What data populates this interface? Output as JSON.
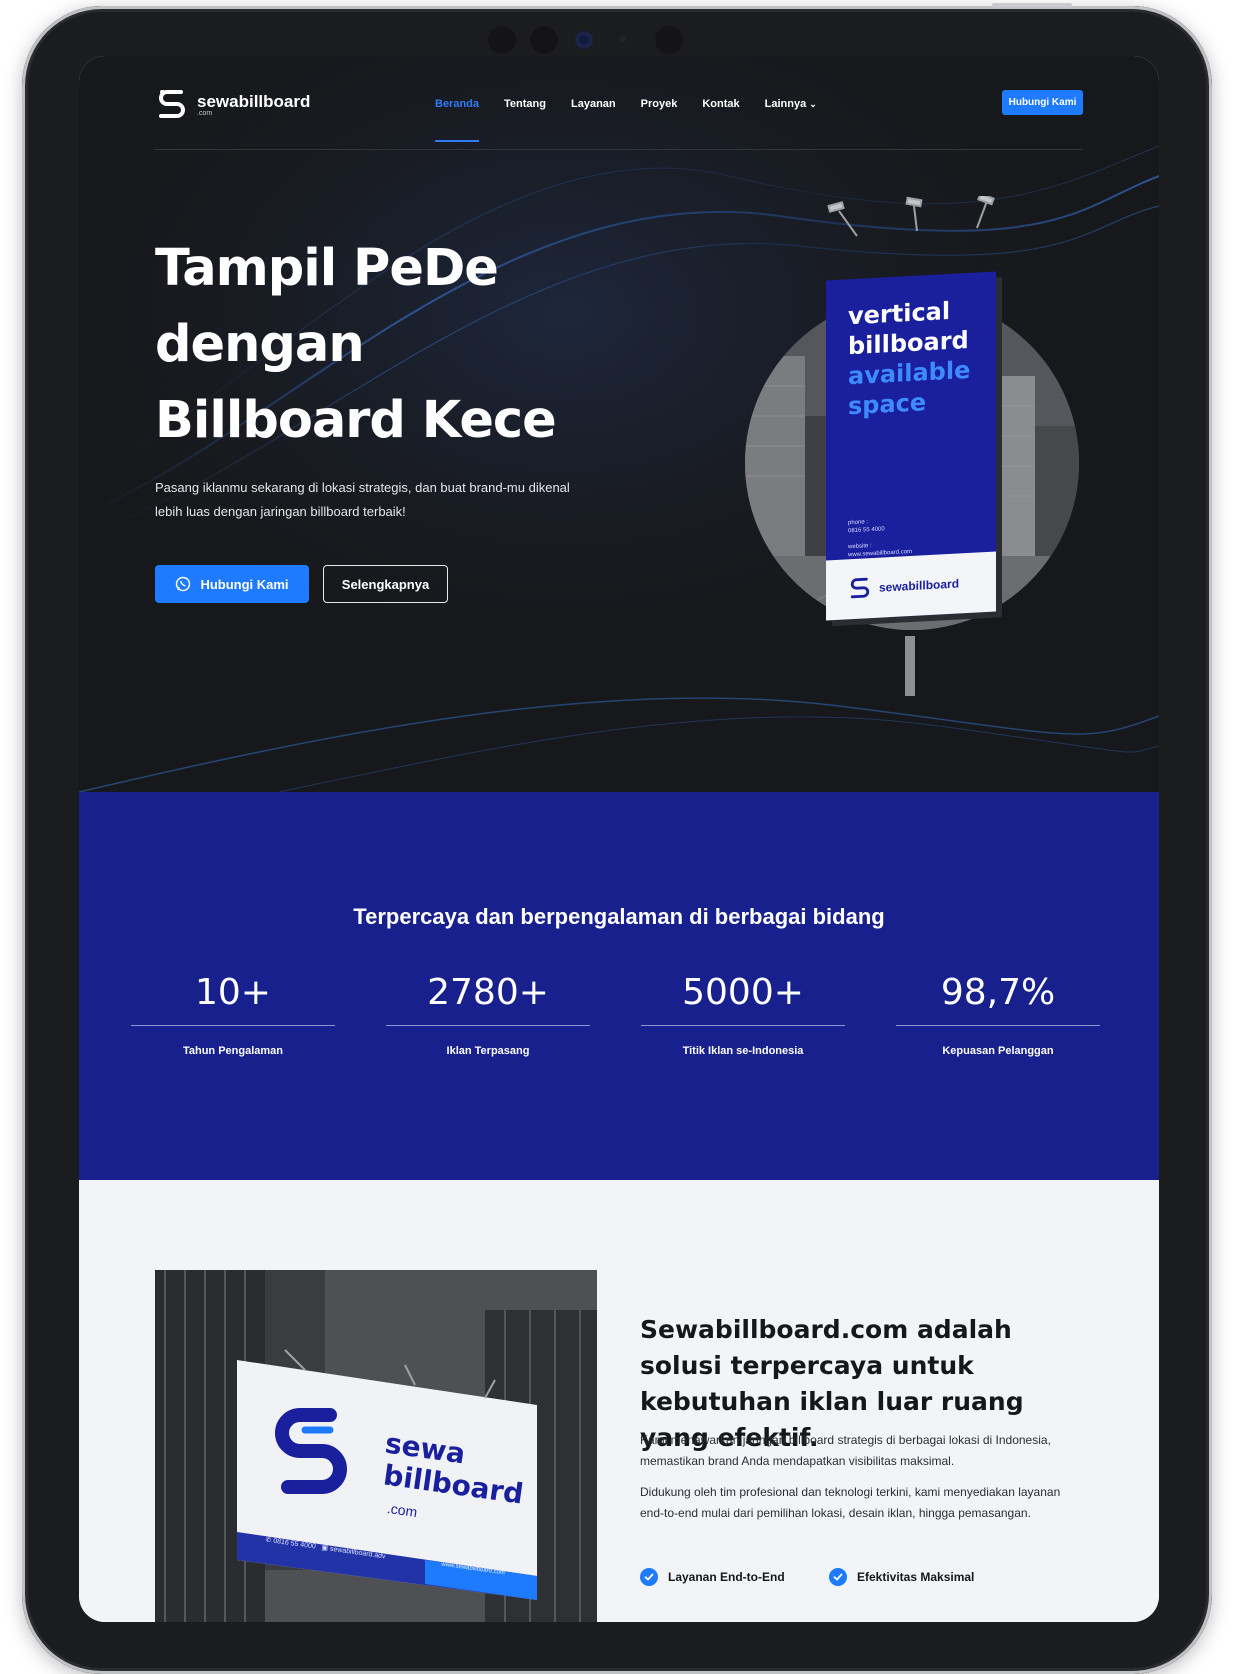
{
  "nav": {
    "logo_name": "sewabillboard",
    "logo_sub": ".com",
    "items": [
      "Beranda",
      "Tentang",
      "Layanan",
      "Proyek",
      "Kontak",
      "Lainnya"
    ],
    "cta": "Hubungi Kami"
  },
  "hero": {
    "title": "Tampil PeDe dengan Billboard Kece",
    "subtitle": "Pasang iklanmu sekarang di lokasi strategis, dan buat brand-mu dikenal lebih luas dengan jaringan billboard terbaik!",
    "primary_button": "Hubungi Kami",
    "secondary_button": "Selengkapnya",
    "billboard": {
      "line1": "vertical",
      "line2": "billboard",
      "line3": "available",
      "line4": "space",
      "phone_label": "phone :",
      "phone": "0816 55 4000",
      "website_label": "website :",
      "website": "www.sewabillboard.com",
      "brand": "sewabillboard"
    }
  },
  "stats": {
    "title": "Terpercaya dan berpengalaman di berbagai bidang",
    "items": [
      {
        "value": "10+",
        "label": "Tahun Pengalaman"
      },
      {
        "value": "2780+",
        "label": "Iklan Terpasang"
      },
      {
        "value": "5000+",
        "label": "Titik Iklan se-Indonesia"
      },
      {
        "value": "98,7%",
        "label": "Kepuasan Pelanggan"
      }
    ]
  },
  "about": {
    "title": "Sewabillboard.com adalah solusi terpercaya untuk kebutuhan iklan luar ruang yang efektif.",
    "p1": "Kami menawarkan jaringan billboard strategis di berbagai lokasi di Indonesia, memastikan brand Anda mendapatkan visibilitas maksimal.",
    "p2": "Didukung oleh tim profesional dan teknologi terkini, kami menyediakan layanan end-to-end mulai dari pemilihan lokasi, desain iklan, hingga pemasangan.",
    "features": [
      "Layanan End-to-End",
      "Efektivitas Maksimal"
    ],
    "image": {
      "sewa": "sewa",
      "billboard": "billboard",
      "com": ".com",
      "phone": "0816 55 4000",
      "instagram": "sewabillboard.adv",
      "website": "www.sewabillboard.com"
    }
  },
  "colors": {
    "accent": "#1e7bff",
    "navy": "#17208d",
    "dark": "#17181b"
  }
}
